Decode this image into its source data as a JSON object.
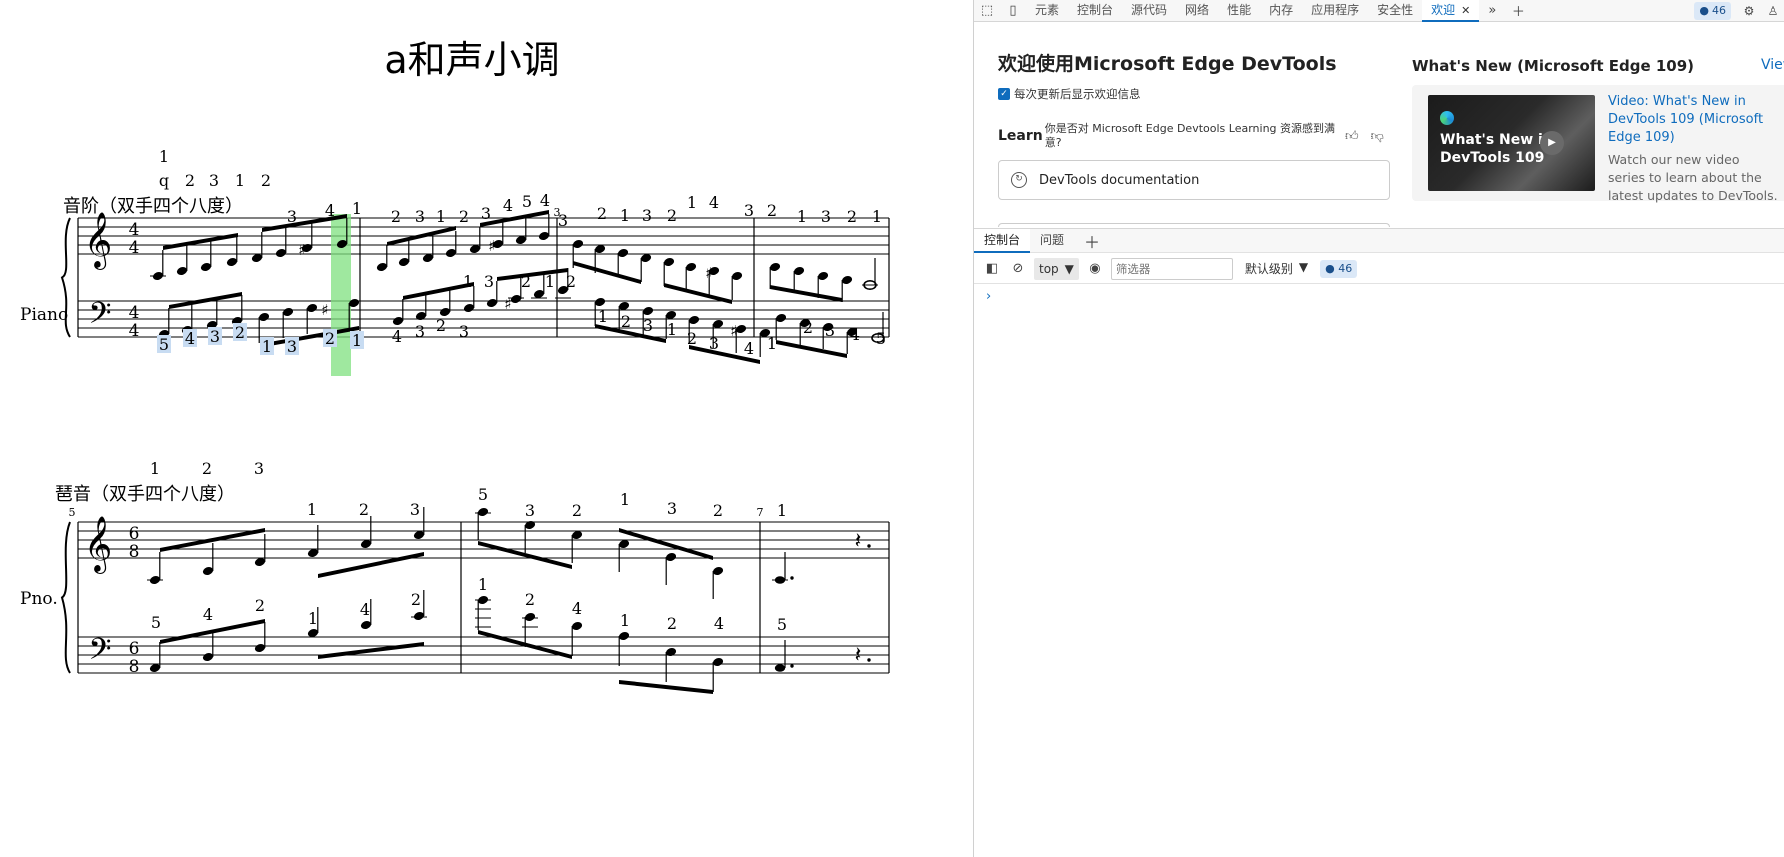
{
  "score": {
    "title": "a和声小调",
    "section1_label": "音阶（双手四个八度）",
    "section2_label": "琶音（双手四个八度）",
    "instrument_full": "Piano",
    "instrument_short": "Pno.",
    "time_sig_1": [
      "4",
      "4"
    ],
    "time_sig_2": [
      "6",
      "8"
    ],
    "measure_numbers": [
      "3",
      "5",
      "7"
    ],
    "fingering_top_row1": [
      "1",
      "q",
      "2",
      "3",
      "1",
      "2"
    ],
    "fingering_sys1_treble": [
      "3",
      "4",
      "1",
      "2",
      "3",
      "1",
      "2",
      "3",
      "4",
      "5",
      "4",
      "3",
      "2",
      "1",
      "3",
      "2",
      "1",
      "4",
      "3",
      "2",
      "1",
      "3",
      "2",
      "1"
    ],
    "fingering_sys1_treble_below": [
      "1",
      "3",
      "2",
      "1",
      "2"
    ],
    "fingering_sys1_bass_highlighted": [
      "5",
      "4",
      "3",
      "2",
      "1",
      "3",
      "2",
      "1"
    ],
    "fingering_sys1_bass": [
      "4",
      "3",
      "2",
      "3",
      "1",
      "2",
      "3",
      "1",
      "2",
      "3",
      "4",
      "1",
      "2",
      "3",
      "4",
      "5"
    ],
    "fingering_top_row2": [
      "1",
      "2",
      "3"
    ],
    "fingering_sys2_treble": [
      "1",
      "2",
      "3",
      "5",
      "3",
      "2",
      "1",
      "3",
      "2",
      "1"
    ],
    "fingering_sys2_bass": [
      "5",
      "4",
      "2",
      "1",
      "4",
      "2",
      "1",
      "2",
      "4",
      "1",
      "2",
      "4",
      "5"
    ]
  },
  "devtools": {
    "tabs": [
      "元素",
      "控制台",
      "源代码",
      "网络",
      "性能",
      "内存",
      "应用程序",
      "安全性",
      "欢迎"
    ],
    "active_tab": "欢迎",
    "issues_count": "46",
    "welcome": {
      "heading": "欢迎使用Microsoft Edge DevTools",
      "show_welcome_checkbox": "每次更新后显示欢迎信息",
      "learn_label": "Learn",
      "learn_question": "你是否对 Microsoft Edge Devtools Learning 资源感到满意?",
      "docs_button": "DevTools documentation",
      "whats_new_heading": "What's New (Microsoft Edge 109)",
      "view_link": "View",
      "thumb_title": "What's New in DevTools 109",
      "video_link": "Video: What's New in DevTools 109 (Microsoft Edge 109)",
      "video_desc": "Watch our new video series to learn about the latest updates to DevTools."
    },
    "drawer_tabs": [
      "控制台",
      "问题"
    ],
    "console": {
      "context": "top",
      "filter_placeholder": "筛选器",
      "level": "默认级别",
      "issues_count": "46",
      "prompt": "›"
    },
    "icons": [
      "inspect-icon",
      "device-icon",
      "more-tabs-icon",
      "add-tab-icon",
      "settings-icon",
      "profile-icon",
      "sidebar-toggle-icon",
      "clear-icon",
      "eye-icon",
      "thumb-up-icon",
      "thumb-down-icon",
      "docs-icon",
      "play-icon",
      "edge-logo-icon"
    ],
    "accent": "#0f6cbd"
  }
}
